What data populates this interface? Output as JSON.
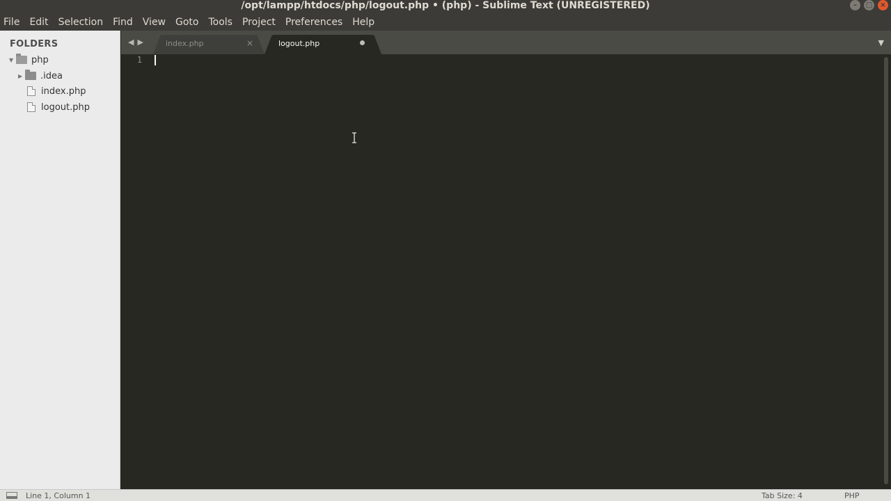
{
  "window": {
    "title": "/opt/lampp/htdocs/php/logout.php • (php) - Sublime Text (UNREGISTERED)",
    "controls": {
      "minimize": "–",
      "maximize": "□",
      "close": "×"
    }
  },
  "menu": {
    "items": [
      "File",
      "Edit",
      "Selection",
      "Find",
      "View",
      "Goto",
      "Tools",
      "Project",
      "Preferences",
      "Help"
    ]
  },
  "sidebar": {
    "header": "FOLDERS",
    "root": {
      "label": "php",
      "icon": "folder-open-icon",
      "expanded": true
    },
    "children": [
      {
        "label": ".idea",
        "type": "folder",
        "icon": "folder-icon",
        "expanded": false
      },
      {
        "label": "index.php",
        "type": "file",
        "icon": "file-icon"
      },
      {
        "label": "logout.php",
        "type": "file",
        "icon": "file-icon"
      }
    ]
  },
  "tabs": [
    {
      "label": "index.php",
      "active": false,
      "indicator": "×"
    },
    {
      "label": "logout.php",
      "active": true,
      "indicator": "●"
    }
  ],
  "tabbar": {
    "nav_left": "◀",
    "nav_right": "▶",
    "dropdown": "▼"
  },
  "editor": {
    "line_numbers": [
      "1"
    ]
  },
  "status": {
    "position": "Line 1, Column 1",
    "tab_size": "Tab Size: 4",
    "syntax": "PHP"
  },
  "colors": {
    "editor_bg": "#272822",
    "tabbar_bg": "#4a4b45",
    "sidebar_bg": "#eaebea",
    "chrome_bg": "#3c3b37",
    "close_button": "#e2572c"
  }
}
